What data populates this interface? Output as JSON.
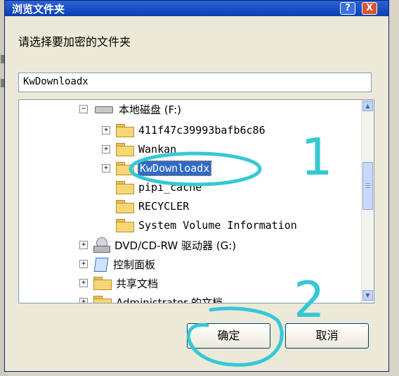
{
  "dialog": {
    "title": "浏览文件夹",
    "help_label": "?",
    "close_label": "X",
    "prompt": "请选择要加密的文件夹",
    "path_value": "KwDownloadx",
    "ok_label": "确定",
    "cancel_label": "取消"
  },
  "tree": {
    "items": [
      {
        "label": "本地磁盘 (F:)",
        "expander": "−"
      },
      {
        "label": "411f47c39993bafb6c86",
        "expander": "+"
      },
      {
        "label": "Wankan",
        "expander": "+"
      },
      {
        "label": "KwDownloadx",
        "expander": "+"
      },
      {
        "label": "pipi_cache",
        "expander": ""
      },
      {
        "label": "RECYCLER",
        "expander": ""
      },
      {
        "label": "System Volume Information",
        "expander": ""
      },
      {
        "label": "DVD/CD-RW 驱动器 (G:)",
        "expander": "+"
      },
      {
        "label": "控制面板",
        "expander": "+"
      },
      {
        "label": "共享文档",
        "expander": "+"
      },
      {
        "label": "Administrator 的文档",
        "expander": "+"
      }
    ],
    "selected_index": 3
  },
  "annotations": {
    "step_one": "1",
    "step_two": "2",
    "color": "#35c8d6"
  }
}
